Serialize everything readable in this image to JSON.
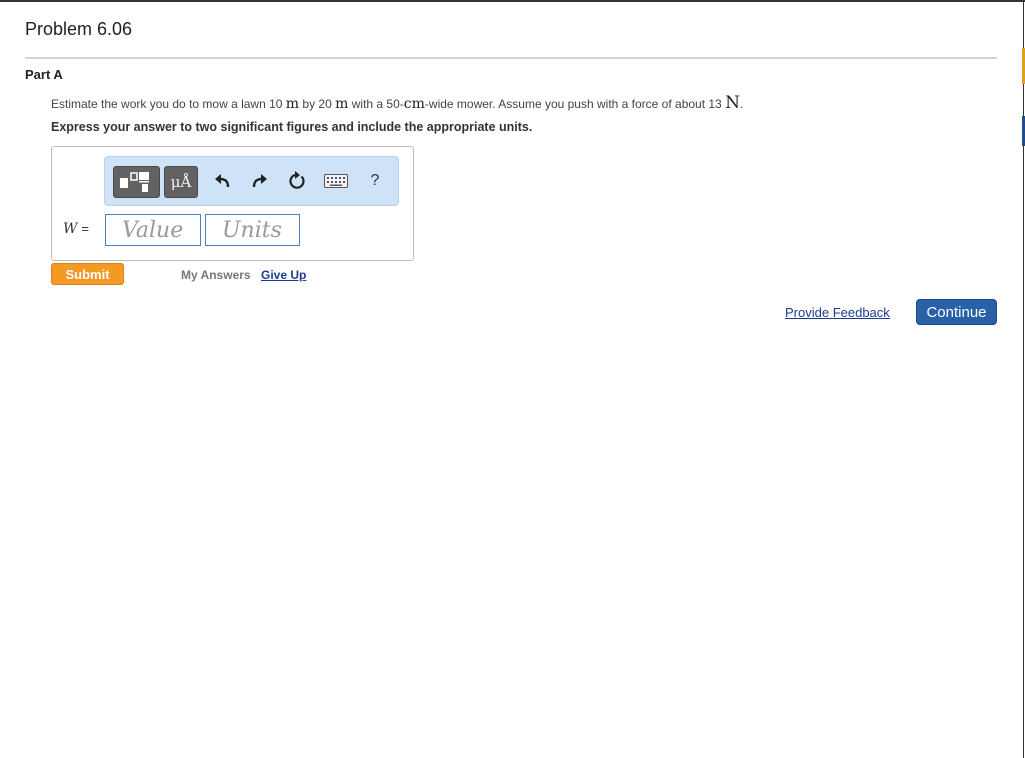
{
  "title": "Problem 6.06",
  "part": "Part A",
  "question": {
    "t1": "Estimate the work you do to mow a lawn 10",
    "u1": "m",
    "t2": "by 20",
    "u2": "m",
    "t3": "with a 50-",
    "u3": "cm",
    "t4": "-wide mower. Assume you push with a force of about 13",
    "u4": "N",
    "t5": "."
  },
  "instruction": "Express your answer to two significant figures and include the appropriate units.",
  "toolbar": {
    "templates_icon": "templates-icon",
    "units_label": "μÅ",
    "undo_icon": "undo-icon",
    "redo_icon": "redo-icon",
    "reset_icon": "reset-icon",
    "keyboard_icon": "keyboard-icon",
    "help_label": "?"
  },
  "answer": {
    "variable": "W",
    "equals": "=",
    "value_placeholder": "Value",
    "units_placeholder": "Units"
  },
  "actions": {
    "submit": "Submit",
    "my_answers": "My Answers",
    "give_up": "Give Up"
  },
  "footer": {
    "feedback": "Provide Feedback",
    "continue": "Continue"
  },
  "colors": {
    "submit": "#f29a24",
    "continue": "#2861a8",
    "link": "#1a3e8c",
    "toolbar": "#cfe3f8"
  }
}
